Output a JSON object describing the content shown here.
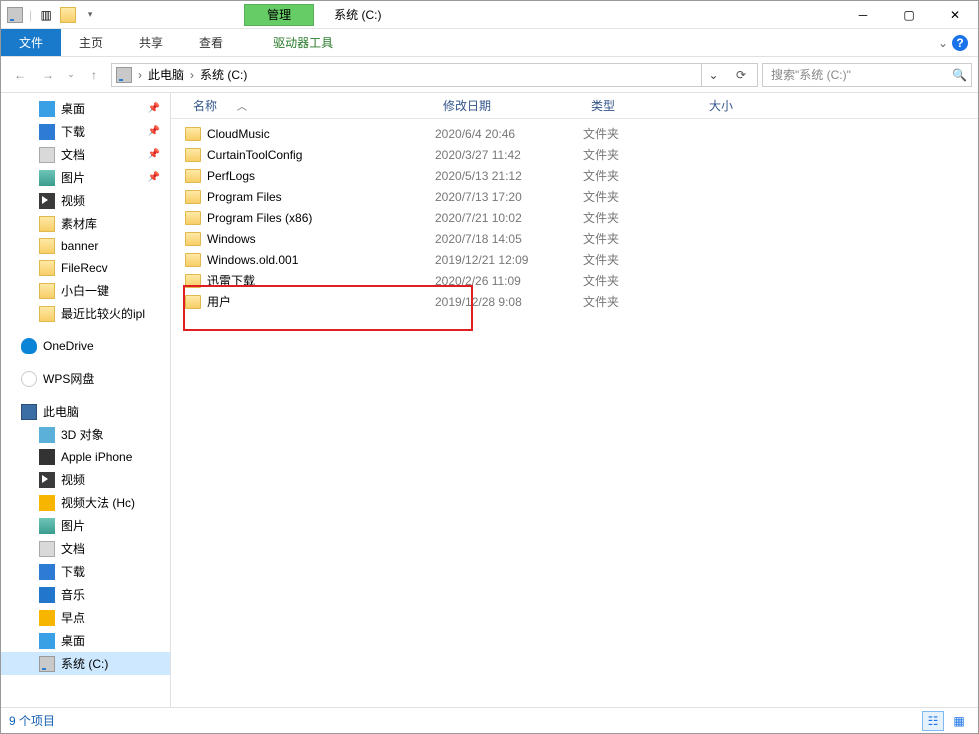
{
  "title": "系统 (C:)",
  "context_tab": "管理",
  "ribbon": {
    "file": "文件",
    "home": "主页",
    "share": "共享",
    "view": "查看",
    "ctx_tool": "驱动器工具"
  },
  "breadcrumb": {
    "seg1": "此电脑",
    "seg2": "系统 (C:)"
  },
  "search": {
    "placeholder": "搜索\"系统 (C:)\""
  },
  "columns": {
    "name": "名称",
    "date": "修改日期",
    "type": "类型",
    "size": "大小"
  },
  "tree": {
    "desktop": "桌面",
    "downloads": "下载",
    "documents": "文档",
    "pictures": "图片",
    "videos": "视频",
    "sucaiku": "素材库",
    "banner": "banner",
    "filerecv": "FileRecv",
    "xiaobai": "小白一键",
    "recent": "最近比较火的ipl",
    "onedrive": "OneDrive",
    "wps": "WPS网盘",
    "thispc": "此电脑",
    "obj3d": "3D 对象",
    "iphone": "Apple iPhone",
    "videos2": "视频",
    "shipindafa": "视频大法 (Hc)",
    "pictures2": "图片",
    "documents2": "文档",
    "downloads2": "下载",
    "music": "音乐",
    "zaodian": "早点",
    "desktop2": "桌面",
    "cdrive": "系统 (C:)"
  },
  "rows": [
    {
      "name": "CloudMusic",
      "date": "2020/6/4 20:46",
      "type": "文件夹"
    },
    {
      "name": "CurtainToolConfig",
      "date": "2020/3/27 11:42",
      "type": "文件夹"
    },
    {
      "name": "PerfLogs",
      "date": "2020/5/13 21:12",
      "type": "文件夹"
    },
    {
      "name": "Program Files",
      "date": "2020/7/13 17:20",
      "type": "文件夹"
    },
    {
      "name": "Program Files (x86)",
      "date": "2020/7/21 10:02",
      "type": "文件夹"
    },
    {
      "name": "Windows",
      "date": "2020/7/18 14:05",
      "type": "文件夹"
    },
    {
      "name": "Windows.old.001",
      "date": "2019/12/21 12:09",
      "type": "文件夹"
    },
    {
      "name": "迅雷下载",
      "date": "2020/2/26 11:09",
      "type": "文件夹"
    },
    {
      "name": "用户",
      "date": "2019/12/28 9:08",
      "type": "文件夹"
    }
  ],
  "status": {
    "count": "9 个项目"
  }
}
